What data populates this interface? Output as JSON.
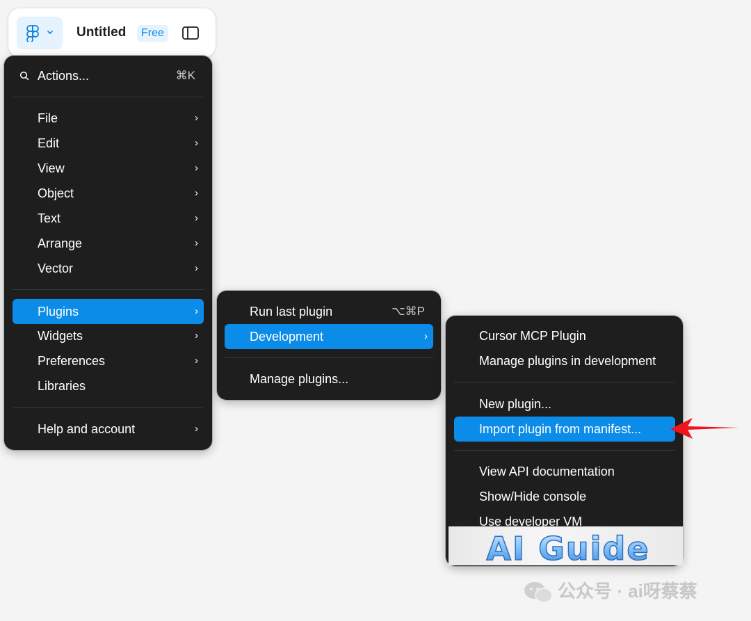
{
  "toolbar": {
    "logo_icon": "figma-logo-icon",
    "document_title": "Untitled",
    "plan_badge": "Free",
    "panel_icon": "sidebar-toggle-icon"
  },
  "main_menu": {
    "search": {
      "label": "Actions...",
      "shortcut": "⌘K"
    },
    "items": [
      {
        "label": "File",
        "submenu": true
      },
      {
        "label": "Edit",
        "submenu": true
      },
      {
        "label": "View",
        "submenu": true
      },
      {
        "label": "Object",
        "submenu": true
      },
      {
        "label": "Text",
        "submenu": true
      },
      {
        "label": "Arrange",
        "submenu": true
      },
      {
        "label": "Vector",
        "submenu": true
      },
      {
        "label": "Plugins",
        "submenu": true,
        "active": true
      },
      {
        "label": "Widgets",
        "submenu": true
      },
      {
        "label": "Preferences",
        "submenu": true
      },
      {
        "label": "Libraries",
        "submenu": false
      },
      {
        "label": "Help and account",
        "submenu": true
      }
    ]
  },
  "plugins_menu": {
    "items": [
      {
        "label": "Run last plugin",
        "shortcut": "⌥⌘P"
      },
      {
        "label": "Development",
        "submenu": true,
        "active": true
      },
      {
        "label": "Manage plugins..."
      }
    ]
  },
  "development_menu": {
    "items": [
      {
        "label": "Cursor MCP Plugin"
      },
      {
        "label": "Manage plugins in development"
      },
      {
        "label": "New plugin..."
      },
      {
        "label": "Import plugin from manifest...",
        "active": true
      },
      {
        "label": "View API documentation"
      },
      {
        "label": "Show/Hide console"
      },
      {
        "label": "Use developer VM"
      }
    ]
  },
  "watermark": {
    "banner_text": "AI Guide",
    "wechat_text": "公众号 · ai呀蔡蔡"
  },
  "colors": {
    "menu_bg": "#1e1e1e",
    "active_blue": "#0c8ce9",
    "badge_blue": "#0d84e4",
    "annotation_red": "#f0141e"
  }
}
